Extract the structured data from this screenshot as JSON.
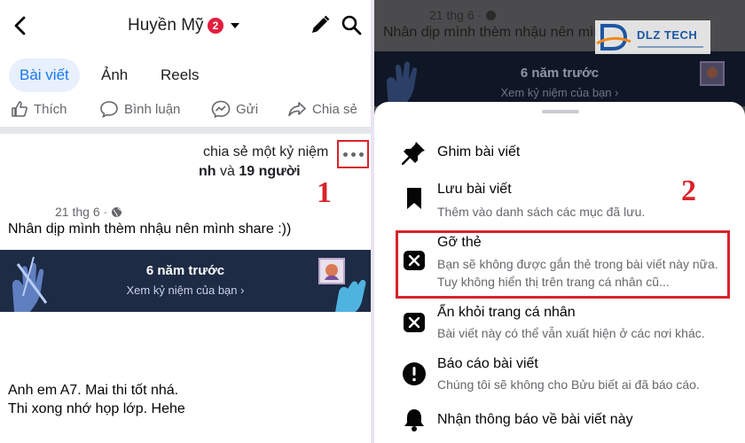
{
  "left": {
    "header": {
      "profile_name": "Huyền Mỹ",
      "notification_count": "2",
      "icons": [
        "back-icon",
        "caret-down-icon",
        "pencil-icon",
        "search-icon"
      ]
    },
    "tabs": [
      {
        "label": "Bài viết",
        "active": true
      },
      {
        "label": "Ảnh",
        "active": false
      },
      {
        "label": "Reels",
        "active": false
      }
    ],
    "actions": [
      {
        "label": "Thích",
        "icon": "like-icon"
      },
      {
        "label": "Bình luận",
        "icon": "comment-icon"
      },
      {
        "label": "Gửi",
        "icon": "messenger-icon"
      },
      {
        "label": "Chia sẻ",
        "icon": "share-icon"
      }
    ],
    "post": {
      "header_line1": "chia sẻ một kỷ niệm",
      "header_line2_name": "nh",
      "header_line2_joiner": "và",
      "header_line2_count": "19 người",
      "date": "21 thg 6 ·",
      "text": "Nhân dịp mình thèm nhậu nên mình share :))",
      "memory_title": "6 năm trước",
      "memory_subtitle": "Xem kỷ niệm của bạn ›",
      "caption_line1": "Anh em A7. Mai thi tốt nhá.",
      "caption_line2": "Thi xong nhớ họp lớp. Hehe"
    },
    "step_marker": "1"
  },
  "right": {
    "background_post": {
      "date": "21 thg 6 ·",
      "text": "Nhân dịp mình thèm nhậu nên mình share :))",
      "memory_title": "6 năm trước",
      "memory_subtitle": "Xem kỷ niệm của bạn ›"
    },
    "watermark": {
      "text": "DLZ TECH"
    },
    "menu": [
      {
        "title": "Ghim bài viết",
        "description": "",
        "icon": "pin-icon"
      },
      {
        "title": "Lưu bài viết",
        "description": "Thêm vào danh sách các mục đã lưu.",
        "icon": "bookmark-icon"
      },
      {
        "title": "Gỡ thẻ",
        "description": "Bạn sẽ không được gắn thẻ trong bài viết này nữa. Tuy không hiển thị trên trang cá nhân cũ...",
        "icon": "close-box-icon"
      },
      {
        "title": "Ẩn khỏi trang cá nhân",
        "description": "Bài viết này có thể vẫn xuất hiện ở các nơi khác.",
        "icon": "close-box-icon"
      },
      {
        "title": "Báo cáo bài viết",
        "description": "Chúng tôi sẽ không cho Bửu biết ai đã báo cáo.",
        "icon": "report-icon"
      },
      {
        "title": "Nhận thông báo về bài viết này",
        "description": "",
        "icon": "bell-icon"
      }
    ],
    "step_marker": "2"
  },
  "colors": {
    "accent_blue": "#1877f2",
    "highlight_red": "#d9232b",
    "memory_banner": "#1e2b45",
    "overlay_dim": "#4b4b4d"
  }
}
